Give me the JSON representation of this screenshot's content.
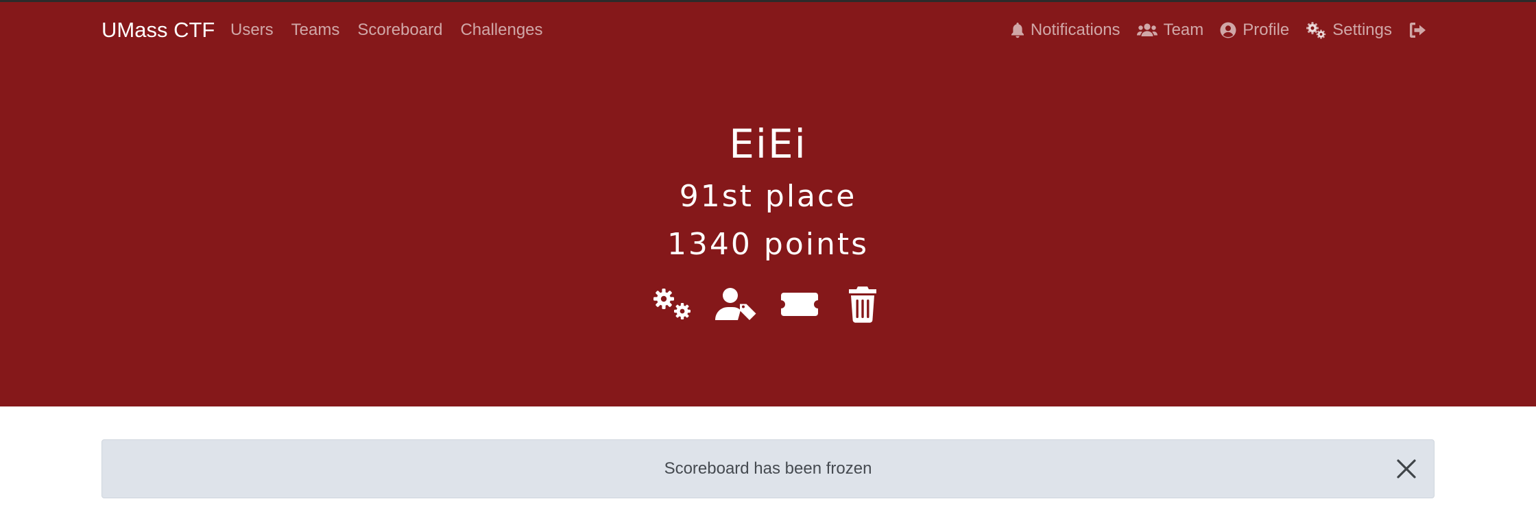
{
  "navbar": {
    "brand": "UMass CTF",
    "left_links": [
      {
        "label": "Users"
      },
      {
        "label": "Teams"
      },
      {
        "label": "Scoreboard"
      },
      {
        "label": "Challenges"
      }
    ],
    "right_links": [
      {
        "label": "Notifications",
        "icon": "bell-icon"
      },
      {
        "label": "Team",
        "icon": "users-icon"
      },
      {
        "label": "Profile",
        "icon": "user-circle-icon"
      },
      {
        "label": "Settings",
        "icon": "cogs-icon"
      }
    ],
    "logout_icon": "sign-out-icon"
  },
  "team": {
    "name": "EiEi",
    "place_number": "91st",
    "place_suffix": "place",
    "points_value": "1340",
    "points_suffix": "points"
  },
  "actions": [
    {
      "icon": "cogs-icon"
    },
    {
      "icon": "user-tag-icon"
    },
    {
      "icon": "ticket-icon"
    },
    {
      "icon": "trash-icon"
    }
  ],
  "alert": {
    "message": "Scoreboard has been frozen"
  },
  "colors": {
    "header_bg": "#85181a",
    "alert_bg": "#dee3ea",
    "nav_text": "rgba(255,255,255,0.62)"
  }
}
